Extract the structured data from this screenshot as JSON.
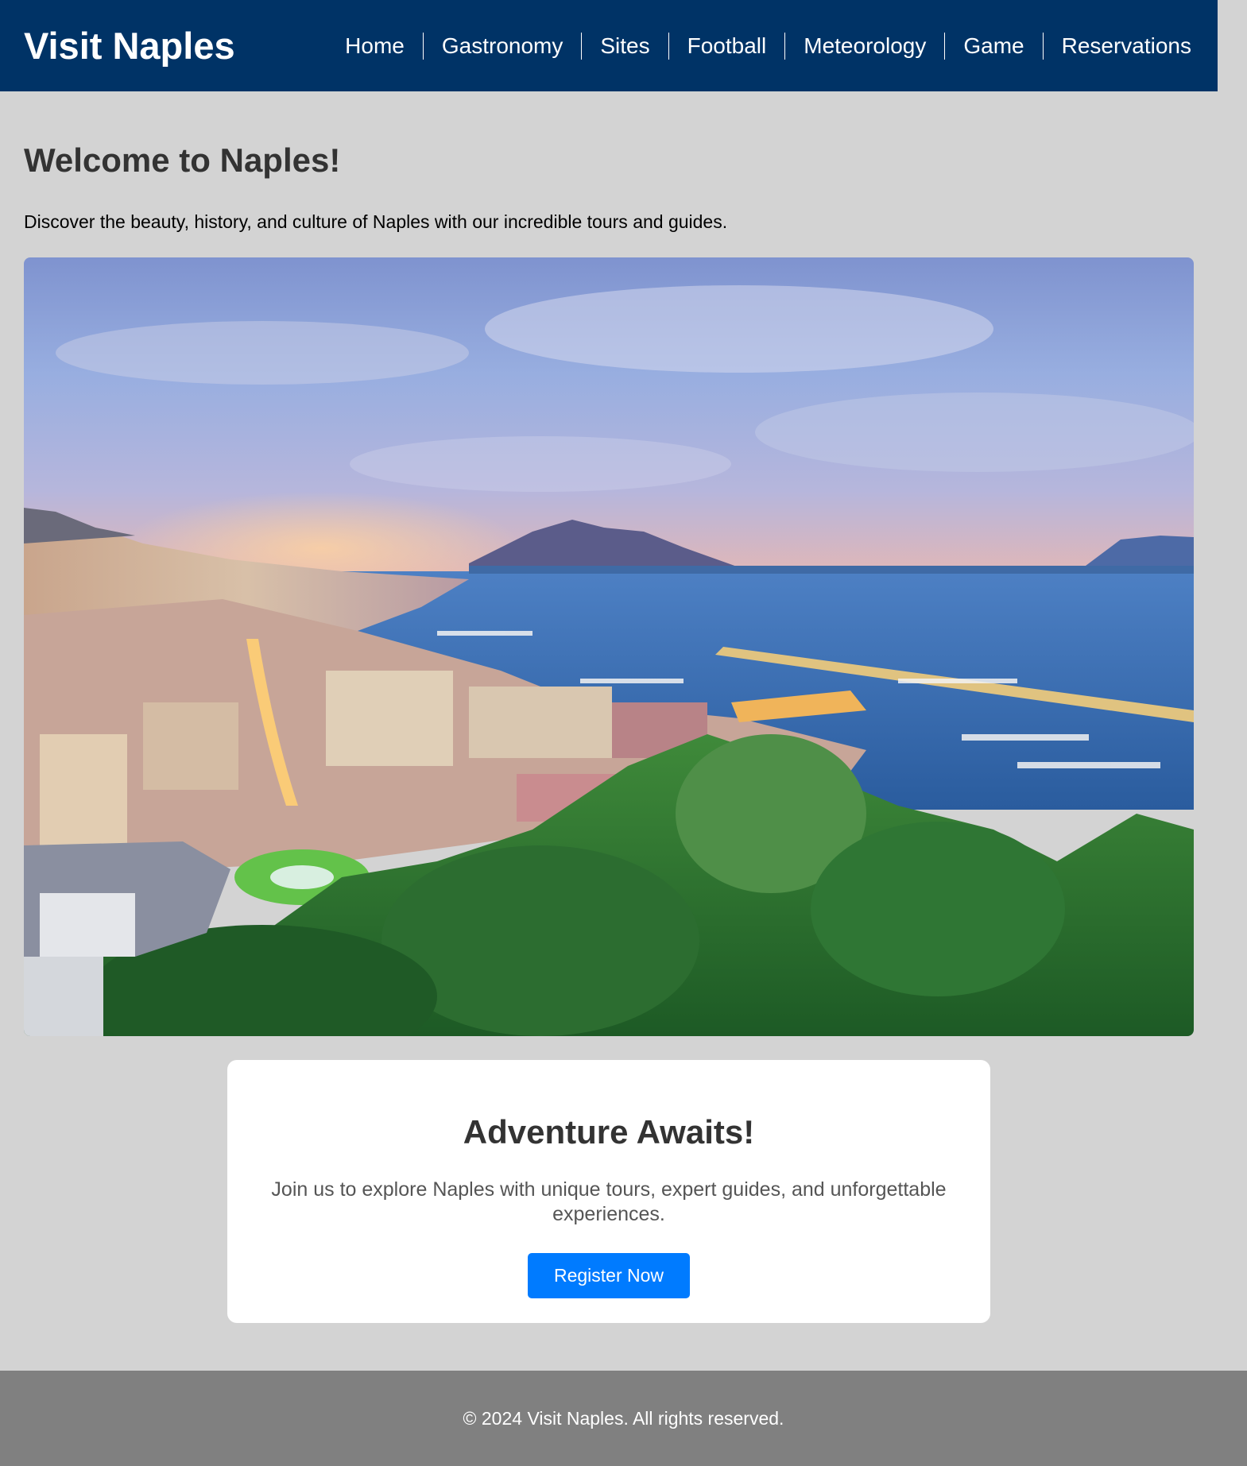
{
  "header": {
    "brand": "Visit Naples",
    "nav": [
      "Home",
      "Gastronomy",
      "Sites",
      "Football",
      "Meteorology",
      "Game",
      "Reservations"
    ]
  },
  "main": {
    "title": "Welcome to Naples!",
    "intro": "Discover the beauty, history, and culture of Naples with our incredible tours and guides."
  },
  "promo": {
    "title": "Adventure Awaits!",
    "text": "Join us to explore Naples with unique tours, expert guides, and unforgettable experiences.",
    "button_label": "Register Now"
  },
  "footer": {
    "text": "© 2024 Visit Naples. All rights reserved."
  },
  "colors": {
    "header_bg": "#003366",
    "page_bg": "#d3d3d3",
    "button_bg": "#007bff",
    "footer_bg": "#808080"
  }
}
